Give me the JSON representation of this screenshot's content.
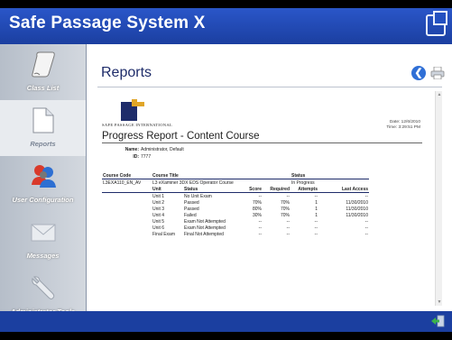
{
  "app": {
    "title": "Safe Passage System X"
  },
  "sidebar": {
    "items": [
      {
        "label": "Class List",
        "icon": "scroll-icon",
        "active": false
      },
      {
        "label": "Reports",
        "icon": "document-icon",
        "active": true
      },
      {
        "label": "User Configuration",
        "icon": "users-icon",
        "active": false
      },
      {
        "label": "Messages",
        "icon": "envelope-icon",
        "active": false
      },
      {
        "label": "Administrator Tools",
        "icon": "wrench-icon",
        "active": false
      }
    ]
  },
  "main": {
    "title": "Reports",
    "back_icon": "back-arrow-icon",
    "print_icon": "print-icon"
  },
  "report": {
    "company": "Safe Passage International",
    "date_label": "Date: 12/6/2010",
    "time_label": "Time: 3:29:51 PM",
    "heading": "Progress Report - Content Course",
    "name_label": "Name:",
    "name_value": "Administrator, Default",
    "id_label": "ID:",
    "id_value": "7777",
    "columns": {
      "course_code": "Course Code",
      "course_title": "Course Title",
      "status": "Status"
    },
    "course": {
      "code": "L3EXA110_EN_AV",
      "title": "L3 eXaminer 3DX EDS Operator Course",
      "status": "In Progress"
    },
    "unit_columns": [
      "Unit",
      "Status",
      "Score",
      "Required",
      "Attempts",
      "Last Access"
    ],
    "units": [
      [
        "Unit 1",
        "No Unit Exam",
        "--",
        "--",
        "--",
        "--"
      ],
      [
        "Unit 2",
        "Passed",
        "70%",
        "70%",
        "1",
        "11/30/2010"
      ],
      [
        "Unit 3",
        "Passed",
        "80%",
        "70%",
        "1",
        "11/30/2010"
      ],
      [
        "Unit 4",
        "Failed",
        "30%",
        "70%",
        "1",
        "11/30/2010"
      ],
      [
        "Unit 5",
        "Exam Not Attempted",
        "--",
        "--",
        "--",
        "--"
      ],
      [
        "Unit 6",
        "Exam Not Attempted",
        "--",
        "--",
        "--",
        "--"
      ],
      [
        "Final Exam",
        "Final Not Attempted",
        "--",
        "--",
        "--",
        "--"
      ]
    ]
  },
  "footer": {
    "logout_icon": "logout-icon"
  }
}
